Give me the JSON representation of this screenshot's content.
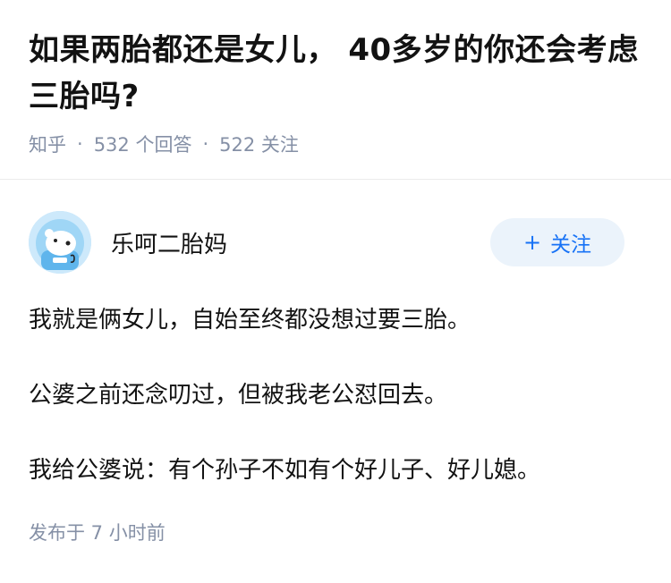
{
  "question": {
    "title": "如果两胎都还是女儿， 40多岁的你还会考虑三胎吗?",
    "source": "知乎",
    "answers_count": "532 个回答",
    "followers_count": "522 关注",
    "separator": "·"
  },
  "answer": {
    "author_name": "乐呵二胎妈",
    "avatar_icon": "polar-bear-astronaut-avatar",
    "follow_label": "关注",
    "follow_plus": "+",
    "paragraphs": [
      "我就是俩女儿，自始至终都没想过要三胎。",
      "公婆之前还念叨过，但被我老公怼回去。",
      "我给公婆说：有个孙子不如有个好儿子、好儿媳。"
    ],
    "published": "发布于 7 小时前"
  },
  "colors": {
    "accent": "#1772f6",
    "follow_bg": "#ebf3fb",
    "meta_gray": "#8590a6",
    "text": "#121212"
  }
}
